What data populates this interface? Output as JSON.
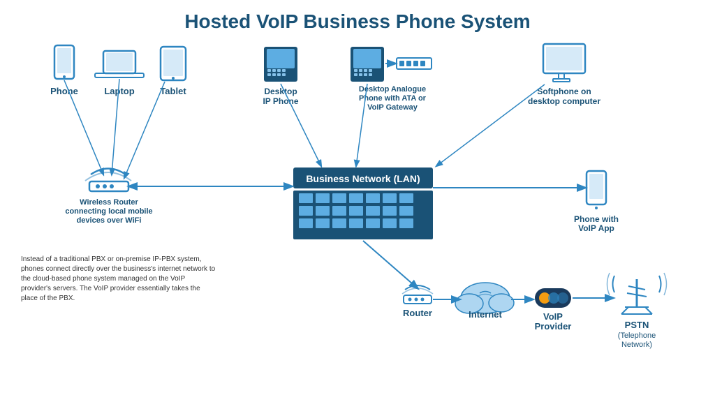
{
  "title": "Hosted VoIP Business Phone System",
  "devices": {
    "phone_label": "Phone",
    "laptop_label": "Laptop",
    "tablet_label": "Tablet",
    "desktop_ip_label": "Desktop\nIP Phone",
    "analogue_label": "Desktop Analogue\nPhone with ATA or\nVoIP Gateway",
    "softphone_label": "Softphone on\ndesktop computer",
    "mobile_label": "Phone with\nVoIP App",
    "wireless_router_label": "Wireless Router\nconnecting local mobile\ndevices over WiFi",
    "router_label": "Router",
    "internet_label": "Internet",
    "voip_provider_label": "VoIP\nProvider",
    "pstn_label": "PSTN\n(Telephone\nNetwork)"
  },
  "lan_label": "Business Network (LAN)",
  "bottom_text": "Instead of a traditional PBX or on-premise IP-PBX system, phones connect directly over the business's internet network to the cloud-based phone system managed on the VoIP provider's servers. The VoIP provider essentially takes the place of the PBX.",
  "colors": {
    "primary": "#1a5276",
    "light_blue": "#5dade2",
    "medium_blue": "#2e86c1",
    "accent": "#f39c12"
  }
}
